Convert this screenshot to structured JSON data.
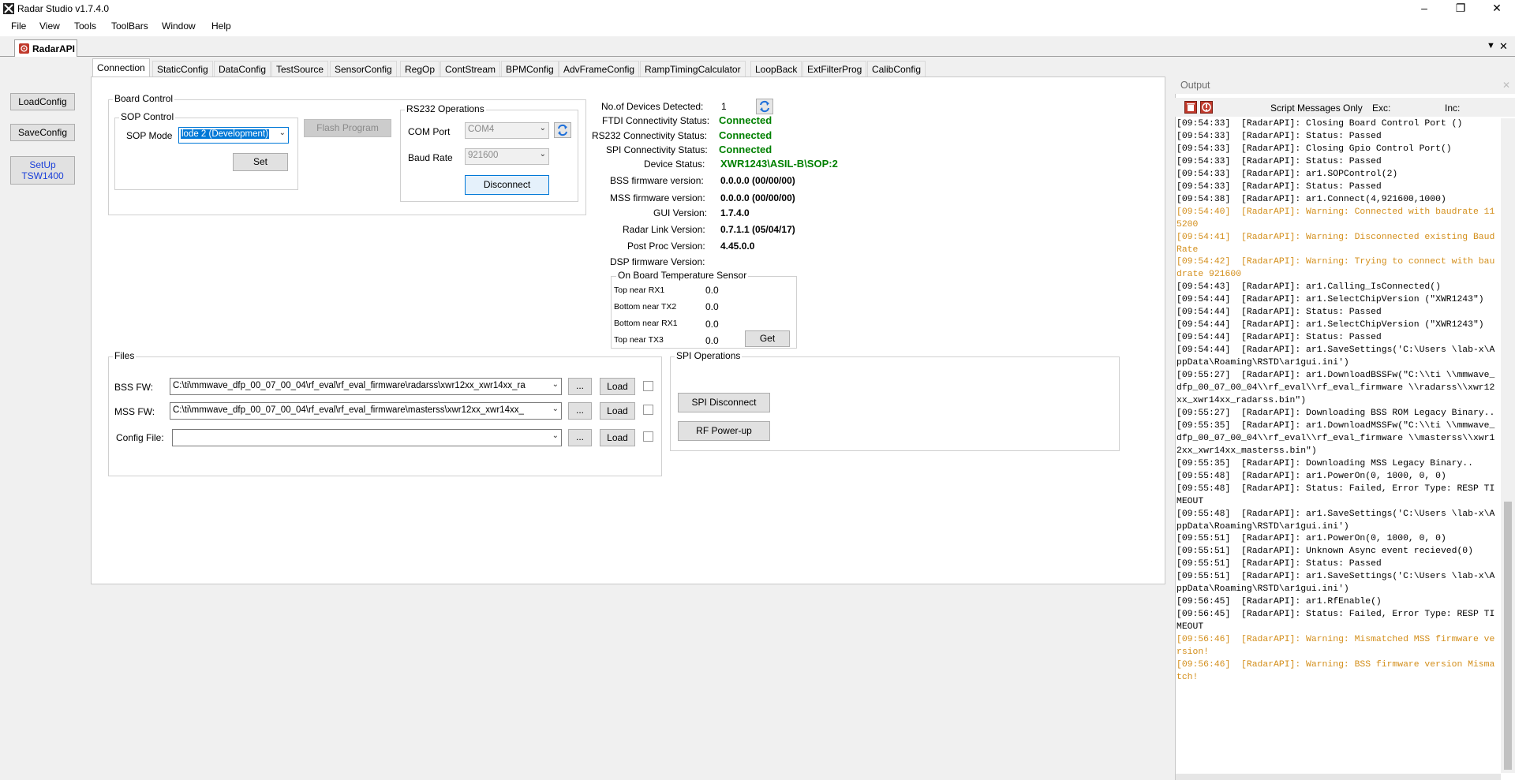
{
  "window": {
    "title": "Radar Studio v1.7.4.0"
  },
  "menu": [
    "File",
    "View",
    "Tools",
    "ToolBars",
    "Window",
    "Help"
  ],
  "doc_tab": {
    "label": "RadarAPI"
  },
  "side_buttons": {
    "load_config": "LoadConfig",
    "save_config": "SaveConfig",
    "setup_line1": "SetUp",
    "setup_line2": "TSW1400"
  },
  "tabs": [
    "Connection",
    "StaticConfig",
    "DataConfig",
    "TestSource",
    "SensorConfig",
    "RegOp",
    "ContStream",
    "BPMConfig",
    "AdvFrameConfig",
    "RampTimingCalculator",
    "LoopBack",
    "ExtFilterProg",
    "CalibConfig"
  ],
  "board_control": {
    "title": "Board Control",
    "sop_title": "SOP Control",
    "sop_mode_label": "SOP Mode",
    "sop_mode_value": "lode 2 (Development)",
    "set_button": "Set",
    "flash_button": "Flash Program"
  },
  "rs232": {
    "title": "RS232 Operations",
    "com_port_label": "COM Port",
    "com_port_value": "COM4",
    "baud_label": "Baud Rate",
    "baud_value": "921600",
    "disconnect_button": "Disconnect"
  },
  "status": {
    "devices_label": "No.of Devices Detected:",
    "devices_value": "1",
    "ftdi_label": "FTDI Connectivity Status:",
    "ftdi_value": "Connected",
    "rs232_label": "RS232 Connectivity Status:",
    "rs232_value": "Connected",
    "spi_label": "SPI Connectivity Status:",
    "spi_value": "Connected",
    "device_label": "Device Status:",
    "device_value": "XWR1243\\ASIL-B\\SOP:2",
    "bss_label": "BSS firmware version:",
    "bss_value": "0.0.0.0 (00/00/00)",
    "mss_label": "MSS firmware version:",
    "mss_value": "0.0.0.0 (00/00/00)",
    "gui_label": "GUI Version:",
    "gui_value": "1.7.4.0",
    "radarlink_label": "Radar Link Version:",
    "radarlink_value": "0.7.1.1 (05/04/17)",
    "postproc_label": "Post Proc Version:",
    "postproc_value": "4.45.0.0",
    "dsp_label": "DSP firmware Version:"
  },
  "temperature": {
    "title": "On Board Temperature Sensor",
    "rows": [
      {
        "label": "Top near RX1",
        "value": "0.0"
      },
      {
        "label": "Bottom near TX2",
        "value": "0.0"
      },
      {
        "label": "Bottom near RX1",
        "value": "0.0"
      },
      {
        "label": "Top near TX3",
        "value": "0.0"
      }
    ],
    "get_button": "Get"
  },
  "files": {
    "title": "Files",
    "bss_label": "BSS FW:",
    "bss_value": "C:\\ti\\mmwave_dfp_00_07_00_04\\rf_eval\\rf_eval_firmware\\radarss\\xwr12xx_xwr14xx_ra",
    "mss_label": "MSS FW:",
    "mss_value": "C:\\ti\\mmwave_dfp_00_07_00_04\\rf_eval\\rf_eval_firmware\\masterss\\xwr12xx_xwr14xx_",
    "config_label": "Config File:",
    "config_value": "",
    "browse": "...",
    "load": "Load"
  },
  "spi": {
    "title": "SPI Operations",
    "disconnect_button": "SPI Disconnect",
    "powerup_button": "RF Power-up"
  },
  "output": {
    "title": "Output",
    "script_only": "Script Messages Only",
    "exc_label": "Exc:",
    "inc_label": "Inc:",
    "warn_color": "#d38e1a",
    "log": [
      {
        "text": "[09:54:33]  [RadarAPI]: Closing Board Control Port ()",
        "warn": false
      },
      {
        "text": "[09:54:33]  [RadarAPI]: Status: Passed",
        "warn": false
      },
      {
        "text": "[09:54:33]  [RadarAPI]: Closing Gpio Control Port()",
        "warn": false
      },
      {
        "text": "[09:54:33]  [RadarAPI]: Status: Passed",
        "warn": false
      },
      {
        "text": "[09:54:33]  [RadarAPI]: ar1.SOPControl(2)",
        "warn": false
      },
      {
        "text": "[09:54:33]  [RadarAPI]: Status: Passed",
        "warn": false
      },
      {
        "text": "[09:54:38]  [RadarAPI]: ar1.Connect(4,921600,1000)",
        "warn": false
      },
      {
        "text": "[09:54:40]  [RadarAPI]: Warning: Connected with baudrate 115200",
        "warn": true
      },
      {
        "text": "[09:54:41]  [RadarAPI]: Warning: Disconnected existing BaudRate",
        "warn": true
      },
      {
        "text": "[09:54:42]  [RadarAPI]: Warning: Trying to connect with baudrate 921600",
        "warn": true
      },
      {
        "text": "[09:54:43]  [RadarAPI]: ar1.Calling_IsConnected()",
        "warn": false
      },
      {
        "text": "[09:54:44]  [RadarAPI]: ar1.SelectChipVersion (\"XWR1243\")",
        "warn": false
      },
      {
        "text": "[09:54:44]  [RadarAPI]: Status: Passed",
        "warn": false
      },
      {
        "text": "[09:54:44]  [RadarAPI]: ar1.SelectChipVersion (\"XWR1243\")",
        "warn": false
      },
      {
        "text": "[09:54:44]  [RadarAPI]: Status: Passed",
        "warn": false
      },
      {
        "text": "[09:54:44]  [RadarAPI]: ar1.SaveSettings('C:\\Users \\lab-x\\AppData\\Roaming\\RSTD\\ar1gui.ini')",
        "warn": false
      },
      {
        "text": "[09:55:27]  [RadarAPI]: ar1.DownloadBSSFw(\"C:\\\\ti \\\\mmwave_dfp_00_07_00_04\\\\rf_eval\\\\rf_eval_firmware \\\\radarss\\\\xwr12xx_xwr14xx_radarss.bin\")",
        "warn": false
      },
      {
        "text": "[09:55:27]  [RadarAPI]: Downloading BSS ROM Legacy Binary..",
        "warn": false
      },
      {
        "text": "[09:55:35]  [RadarAPI]: ar1.DownloadMSSFw(\"C:\\\\ti \\\\mmwave_dfp_00_07_00_04\\\\rf_eval\\\\rf_eval_firmware \\\\masterss\\\\xwr12xx_xwr14xx_masterss.bin\")",
        "warn": false
      },
      {
        "text": "[09:55:35]  [RadarAPI]: Downloading MSS Legacy Binary..",
        "warn": false
      },
      {
        "text": "[09:55:48]  [RadarAPI]: ar1.PowerOn(0, 1000, 0, 0)",
        "warn": false
      },
      {
        "text": "[09:55:48]  [RadarAPI]: Status: Failed, Error Type: RESP TIMEOUT",
        "warn": false
      },
      {
        "text": "[09:55:48]  [RadarAPI]: ar1.SaveSettings('C:\\Users \\lab-x\\AppData\\Roaming\\RSTD\\ar1gui.ini')",
        "warn": false
      },
      {
        "text": "[09:55:51]  [RadarAPI]: ar1.PowerOn(0, 1000, 0, 0)",
        "warn": false
      },
      {
        "text": "[09:55:51]  [RadarAPI]: Unknown Async event recieved(0)",
        "warn": false
      },
      {
        "text": "[09:55:51]  [RadarAPI]: Status: Passed",
        "warn": false
      },
      {
        "text": "[09:55:51]  [RadarAPI]: ar1.SaveSettings('C:\\Users \\lab-x\\AppData\\Roaming\\RSTD\\ar1gui.ini')",
        "warn": false
      },
      {
        "text": "[09:56:45]  [RadarAPI]: ar1.RfEnable()",
        "warn": false
      },
      {
        "text": "[09:56:45]  [RadarAPI]: Status: Failed, Error Type: RESP TIMEOUT",
        "warn": false
      },
      {
        "text": "[09:56:46]  [RadarAPI]: Warning: Mismatched MSS firmware version!",
        "warn": true
      },
      {
        "text": "[09:56:46]  [RadarAPI]: Warning: BSS firmware version Mismatch!",
        "warn": true
      }
    ]
  }
}
